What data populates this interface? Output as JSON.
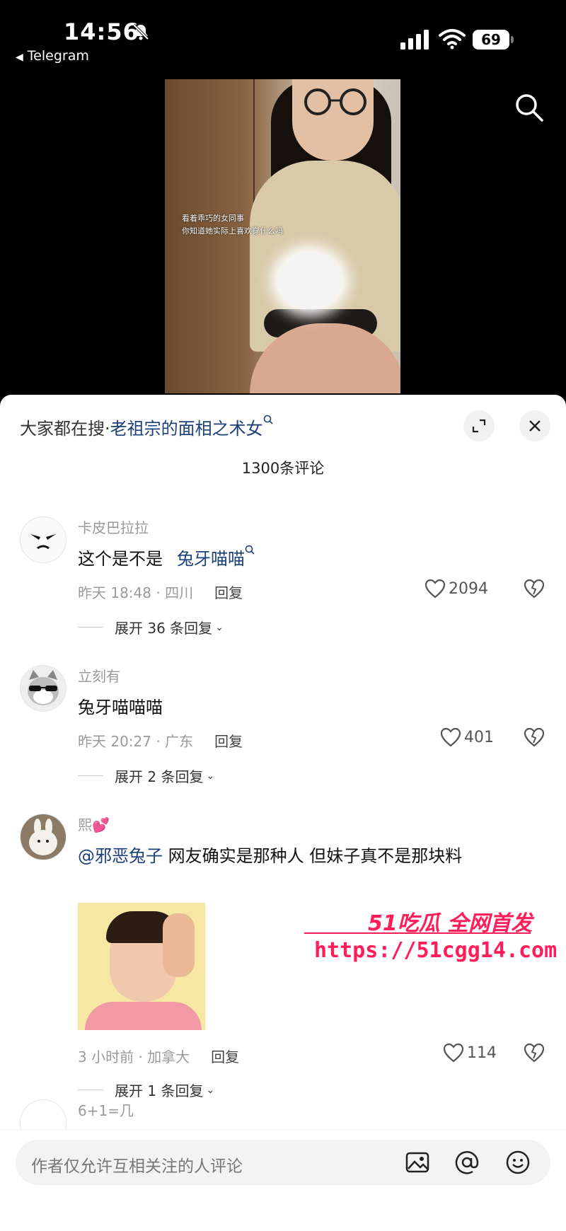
{
  "status_bar": {
    "time": "14:56",
    "back_app": "Telegram",
    "battery": "69"
  },
  "video": {
    "caption_line1": "看着乖巧的女同事",
    "caption_line2": "你知道她实际上喜欢穿什么吗"
  },
  "sheet": {
    "hot_search_prefix": "大家都在搜·",
    "hot_search_keyword": "老祖宗的面相之术女",
    "comment_count": "1300条评论"
  },
  "comments": [
    {
      "user": "卡皮巴拉拉",
      "text": "这个是不是",
      "keyword": "兔牙喵喵",
      "meta": "昨天 18:48 · 四川",
      "reply": "回复",
      "likes": "2094",
      "expand": "展开 36 条回复"
    },
    {
      "user": "立刻有",
      "text": "兔牙喵喵喵",
      "meta": "昨天 20:27 · 广东",
      "reply": "回复",
      "likes": "401",
      "expand": "展开 2 条回复"
    },
    {
      "user": "熙💕",
      "mention": "@邪恶兔子",
      "text": " 网友确实是那种人 但妹子真不是那块料",
      "meta": "3 小时前 · 加拿大",
      "reply": "回复",
      "likes": "114",
      "expand": "展开 1 条回复"
    },
    {
      "user": "6+1=几"
    }
  ],
  "watermark": {
    "top": "51吃瓜 全网首发",
    "url": "https://51cgg14.com"
  },
  "input": {
    "placeholder": "作者仅允许互相关注的人评论"
  },
  "colors": {
    "link": "#1d3f7a",
    "watermark": "#ff1e5a"
  }
}
